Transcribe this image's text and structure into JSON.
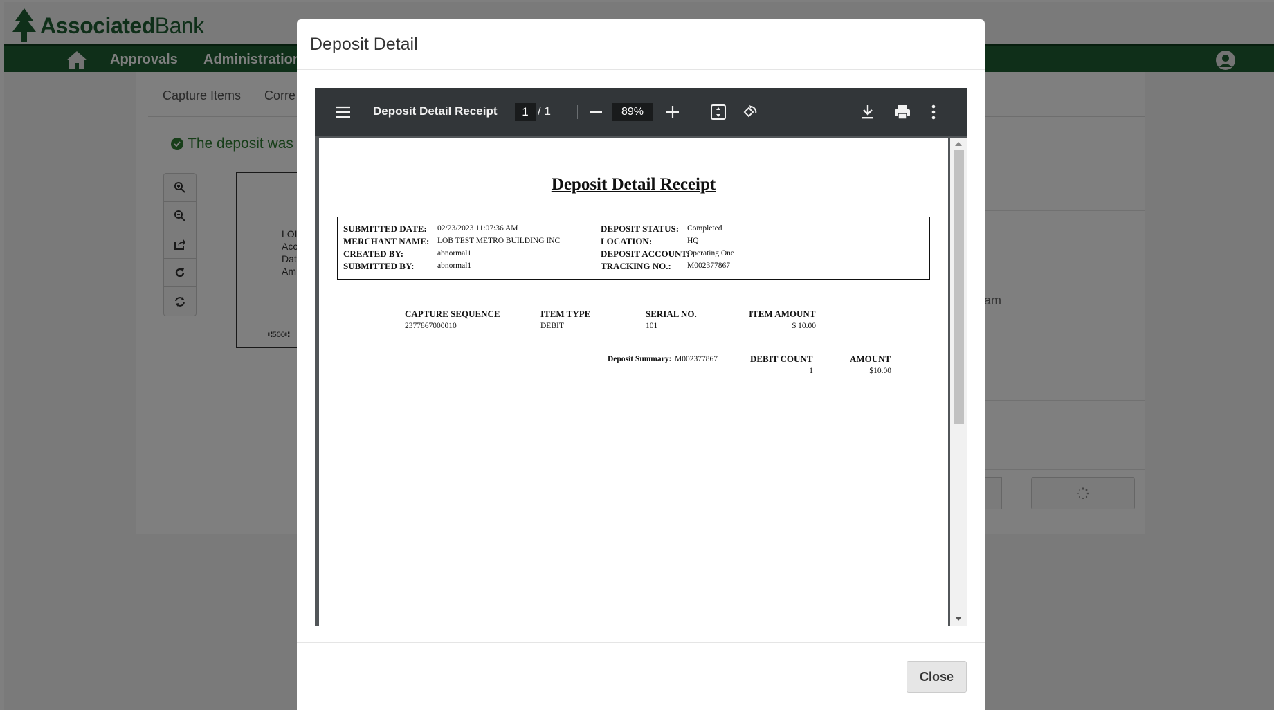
{
  "app": {
    "brand_bold": "Associated",
    "brand_light": "Bank",
    "nav": [
      "Approvals",
      "Administration"
    ],
    "subtabs": [
      "Capture Items",
      "Corre"
    ],
    "success_message": "The deposit was s",
    "thumb_lines": [
      "LOI",
      "Acc",
      "Dat",
      "Am"
    ],
    "thumb_micr": "⑆500⑆",
    "right_fragment": "am",
    "brand_color": "#1f5f32"
  },
  "modal": {
    "title": "Deposit Detail",
    "close_label": "Close"
  },
  "viewer": {
    "doc_title": "Deposit Detail Receipt",
    "page_current": "1",
    "page_total": "/ 1",
    "zoom": "89%",
    "icons": [
      "menu-icon",
      "zoom-out-icon",
      "zoom-in-icon",
      "fit-page-icon",
      "rotate-icon",
      "download-icon",
      "print-icon",
      "more-options-icon"
    ]
  },
  "receipt": {
    "title": "Deposit Detail Receipt",
    "info_left": [
      {
        "label": "SUBMITTED DATE:",
        "value": "02/23/2023 11:07:36 AM"
      },
      {
        "label": "MERCHANT NAME:",
        "value": "LOB TEST METRO BUILDING INC"
      },
      {
        "label": "CREATED BY:",
        "value": "abnormal1"
      },
      {
        "label": "SUBMITTED BY:",
        "value": "abnormal1"
      }
    ],
    "info_right": [
      {
        "label": "DEPOSIT STATUS:",
        "value": "Completed"
      },
      {
        "label": "LOCATION:",
        "value": "HQ"
      },
      {
        "label": "DEPOSIT ACCOUNT:",
        "value": "Operating One"
      },
      {
        "label": "TRACKING NO.:",
        "value": "M002377867"
      }
    ],
    "items_headers": [
      "CAPTURE SEQUENCE",
      "ITEM TYPE",
      "SERIAL NO.",
      "ITEM AMOUNT"
    ],
    "items": [
      {
        "sequence": "2377867000010",
        "type": "DEBIT",
        "serial": "101",
        "amount": "$ 10.00"
      }
    ],
    "summary_label": "Deposit Summary:",
    "summary_value": "M002377867",
    "summary_headers": [
      "DEBIT COUNT",
      "AMOUNT"
    ],
    "summary_count": "1",
    "summary_amount": "$10.00"
  }
}
